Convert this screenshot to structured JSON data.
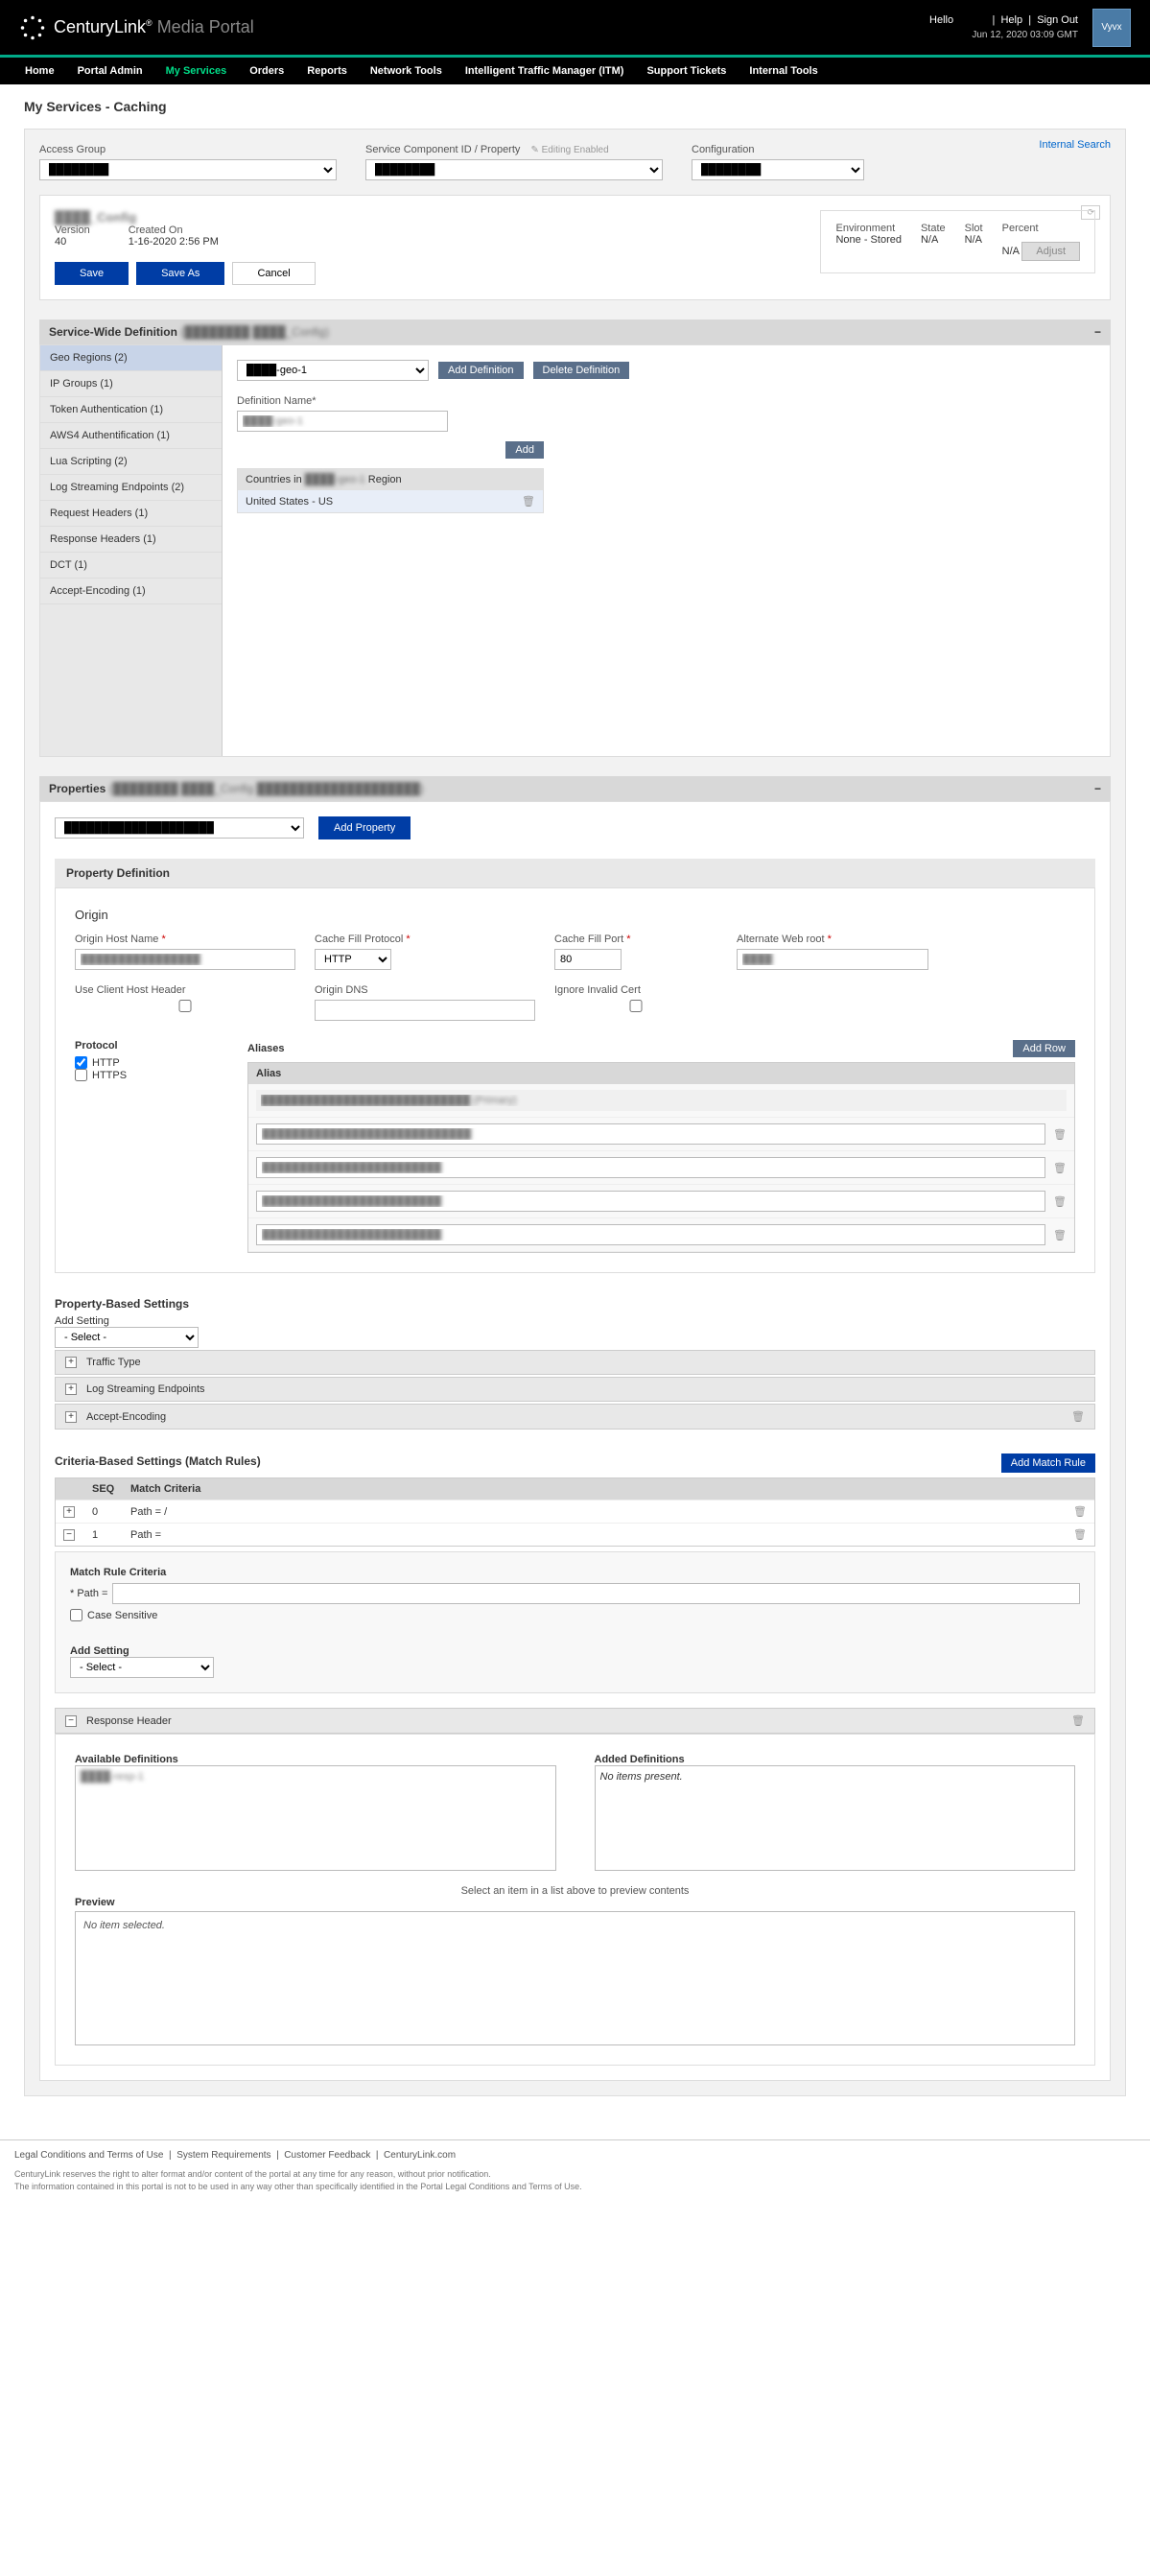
{
  "header": {
    "brand": "CenturyLink",
    "brand_sub": "Media Portal",
    "hello": "Hello",
    "username": "████",
    "help": "Help",
    "signout": "Sign Out",
    "timestamp": "Jun 12, 2020 03:09 GMT",
    "partner": "Vyvx"
  },
  "nav": {
    "items": [
      "Home",
      "Portal Admin",
      "My Services",
      "Orders",
      "Reports",
      "Network Tools",
      "Intelligent Traffic Manager (ITM)",
      "Support Tickets",
      "Internal Tools"
    ],
    "active": "My Services"
  },
  "page": {
    "title": "My Services - Caching",
    "internal_search": "Internal Search"
  },
  "filters": {
    "access_group_label": "Access Group",
    "access_group_value": "████████",
    "service_label": "Service Component ID / Property",
    "service_hint": "✎ Editing Enabled",
    "service_value": "████████",
    "config_label": "Configuration",
    "config_value": "████████"
  },
  "config": {
    "name": "████_Config",
    "version_label": "Version",
    "version": "40",
    "created_label": "Created On",
    "created": "1-16-2020 2:56 PM",
    "save": "Save",
    "save_as": "Save As",
    "cancel": "Cancel",
    "env_label": "Environment",
    "env_value": "None - Stored",
    "state_label": "State",
    "state_value": "N/A",
    "slot_label": "Slot",
    "slot_value": "N/A",
    "percent_label": "Percent",
    "percent_value": "N/A",
    "adjust": "Adjust"
  },
  "swd": {
    "title": "Service-Wide Definition",
    "title_suffix": "(████████ ████_Config)",
    "sidebar": [
      "Geo Regions (2)",
      "IP Groups (1)",
      "Token Authentication (1)",
      "AWS4 Authentification (1)",
      "Lua Scripting (2)",
      "Log Streaming Endpoints (2)",
      "Request Headers (1)",
      "Response Headers (1)",
      "DCT (1)",
      "Accept-Encoding (1)"
    ],
    "region_select": "████-geo-1",
    "add_def": "Add Definition",
    "del_def": "Delete Definition",
    "def_name_label": "Definition Name*",
    "def_name_value": "████-geo-1",
    "add": "Add",
    "countries_label": "Countries in ████-geo-1 Region",
    "country_row": "United States - US"
  },
  "props": {
    "title": "Properties",
    "title_suffix": "(████████ ████_Config ████████████████████)",
    "select_value": "████████████████████",
    "add_property": "Add Property",
    "prop_def": "Property Definition"
  },
  "origin": {
    "title": "Origin",
    "host_label": "Origin Host Name",
    "host_value": "████████████████",
    "protocol_label": "Cache Fill Protocol",
    "protocol_value": "HTTP",
    "port_label": "Cache Fill Port",
    "port_value": "80",
    "webroot_label": "Alternate Web root",
    "webroot_value": "████",
    "client_host_label": "Use Client Host Header",
    "dns_label": "Origin DNS",
    "ignore_cert_label": "Ignore Invalid Cert",
    "proto_title": "Protocol",
    "http": "HTTP",
    "https": "HTTPS",
    "aliases_title": "Aliases",
    "add_row": "Add Row",
    "alias_col": "Alias",
    "aliases": [
      "████████████████████████████ (Primary)",
      "████████████████████████████",
      "████████████████████████",
      "████████████████████████",
      "████████████████████████"
    ]
  },
  "pbs": {
    "title": "Property-Based Settings",
    "add_setting": "Add Setting",
    "select": "- Select -",
    "rows": [
      "Traffic Type",
      "Log Streaming Endpoints",
      "Accept-Encoding"
    ]
  },
  "cbs": {
    "title": "Criteria-Based Settings (Match Rules)",
    "add_rule": "Add Match Rule",
    "col_seq": "SEQ",
    "col_match": "Match Criteria",
    "rows": [
      {
        "seq": "0",
        "path": "Path = /"
      },
      {
        "seq": "1",
        "path": "Path ="
      }
    ],
    "rule_criteria": "Match Rule Criteria",
    "path_label": "* Path =",
    "case_sensitive": "Case Sensitive",
    "add_setting": "Add Setting",
    "select": "- Select -"
  },
  "resp": {
    "title": "Response Header",
    "available": "Available Definitions",
    "available_item": "████-resp-1",
    "added": "Added Definitions",
    "no_items": "No items present.",
    "preview": "Preview",
    "preview_hint": "Select an item in a list above to preview contents",
    "no_selected": "No item selected."
  },
  "footer": {
    "links": [
      "Legal Conditions and Terms of Use",
      "System Requirements",
      "Customer Feedback",
      "CenturyLink.com"
    ],
    "disclaimer1": "CenturyLink reserves the right to alter format and/or content of the portal at any time for any reason, without prior notification.",
    "disclaimer2": "The information contained in this portal is not to be used in any way other than specifically identified in the Portal Legal Conditions and Terms of Use."
  }
}
